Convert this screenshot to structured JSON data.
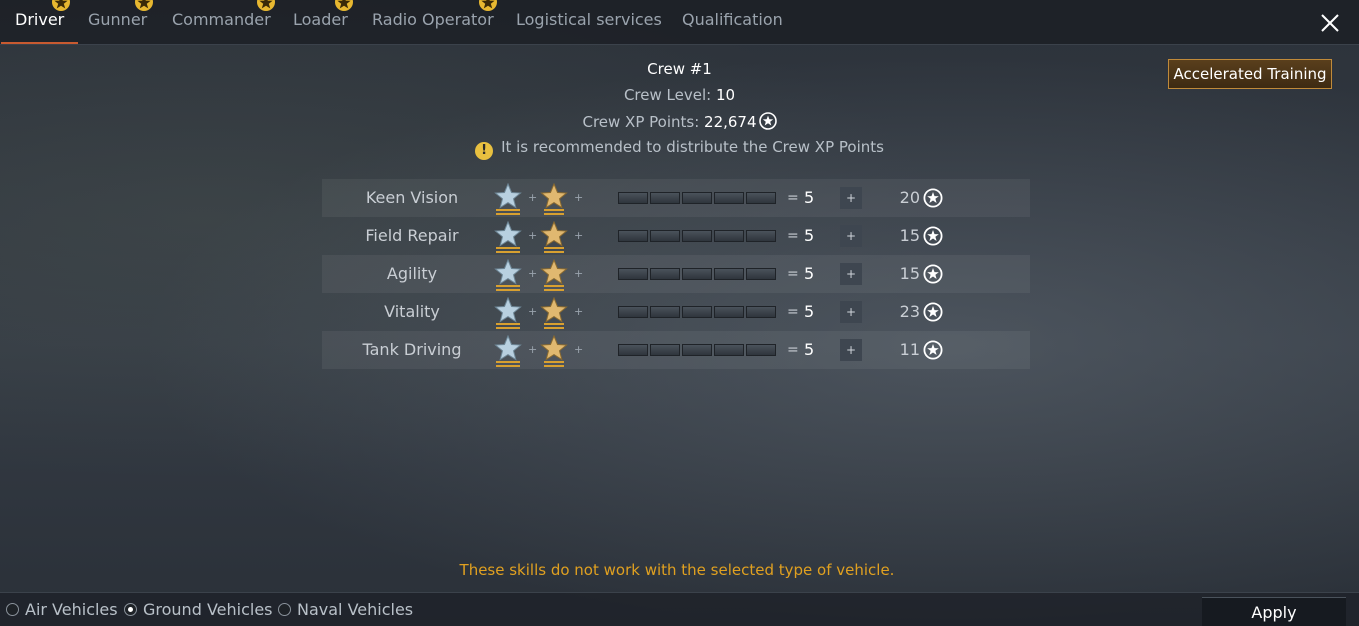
{
  "tabs": [
    {
      "label": "Driver",
      "active": true,
      "badge": true
    },
    {
      "label": "Gunner",
      "active": false,
      "badge": true
    },
    {
      "label": "Commander",
      "active": false,
      "badge": true
    },
    {
      "label": "Loader",
      "active": false,
      "badge": true
    },
    {
      "label": "Radio Operator",
      "active": false,
      "badge": true
    },
    {
      "label": "Logistical services",
      "active": false,
      "badge": false
    },
    {
      "label": "Qualification",
      "active": false,
      "badge": false
    }
  ],
  "header": {
    "crew_title": "Crew #1",
    "crew_level_label": "Crew Level:",
    "crew_level_value": "10",
    "xp_label": "Crew XP Points:",
    "xp_value": "22,674",
    "recommend_text": "It is recommended to distribute the Crew XP Points",
    "accelerated_training_label": "Accelerated Training"
  },
  "skills": [
    {
      "name": "Keen Vision",
      "value": "5",
      "cost": "20"
    },
    {
      "name": "Field Repair",
      "value": "5",
      "cost": "15"
    },
    {
      "name": "Agility",
      "value": "5",
      "cost": "15"
    },
    {
      "name": "Vitality",
      "value": "5",
      "cost": "23"
    },
    {
      "name": "Tank Driving",
      "value": "5",
      "cost": "11"
    }
  ],
  "skill_symbols": {
    "plus": "+",
    "equals": "=",
    "increase": "+"
  },
  "notice": "These skills do not work with the selected type of vehicle.",
  "vehicle_types": [
    {
      "label": "Air Vehicles",
      "selected": false
    },
    {
      "label": "Ground Vehicles",
      "selected": true
    },
    {
      "label": "Naval Vehicles",
      "selected": false
    }
  ],
  "apply_label": "Apply",
  "colors": {
    "accent_orange": "#c85a30",
    "notice_yellow": "#e0a020",
    "badge_gold": "#e8b830"
  }
}
